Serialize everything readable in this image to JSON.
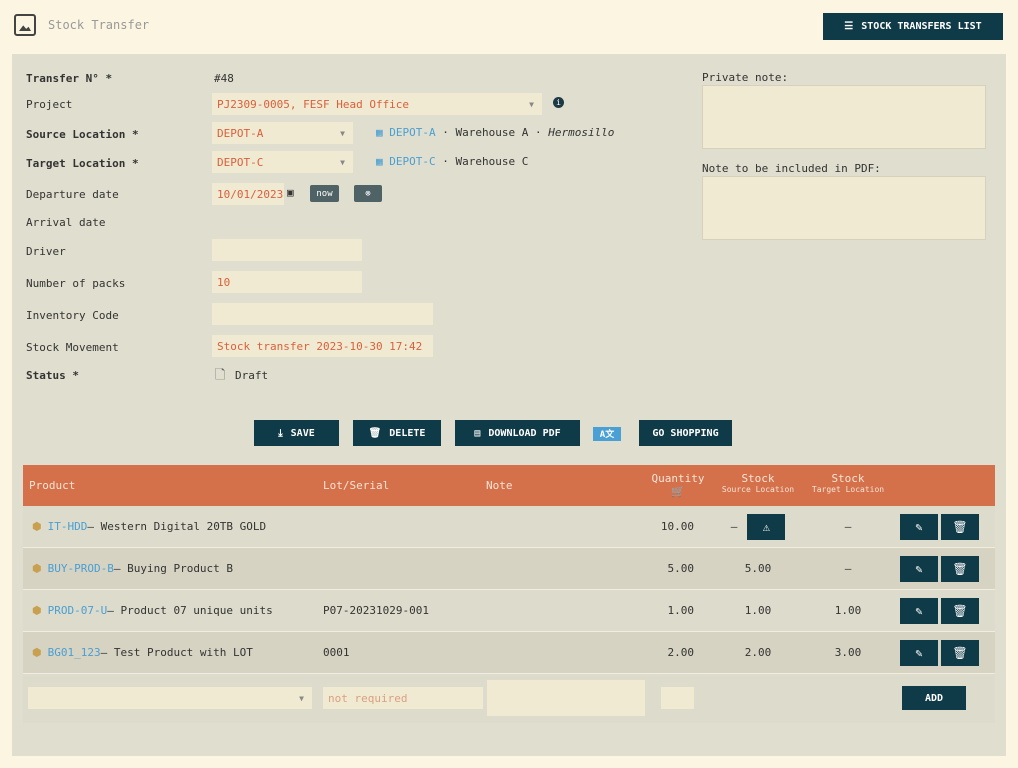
{
  "header": {
    "title": "Stock Transfer",
    "list_button": "STOCK TRANSFERS LIST"
  },
  "form": {
    "transfer_no": {
      "label": "Transfer N° *",
      "value": "#48"
    },
    "project": {
      "label": "Project",
      "value": "PJ2309-0005, FESF Head Office"
    },
    "source": {
      "label": "Source Location *",
      "value": "DEPOT-A",
      "ref": "DEPOT-A",
      "desc": " · Warehouse A · ",
      "city": "Hermosillo"
    },
    "target": {
      "label": "Target Location *",
      "value": "DEPOT-C",
      "ref": "DEPOT-C",
      "desc": " · Warehouse C"
    },
    "departure": {
      "label": "Departure date",
      "value": "10/01/2023",
      "now": "now"
    },
    "arrival": {
      "label": "Arrival date"
    },
    "driver": {
      "label": "Driver",
      "value": ""
    },
    "packs": {
      "label": "Number of packs",
      "value": "10"
    },
    "inventory_code": {
      "label": "Inventory Code",
      "value": ""
    },
    "movement": {
      "label": "Stock Movement",
      "value": "Stock transfer 2023-10-30 17:42"
    },
    "status": {
      "label": "Status *",
      "value": "Draft"
    },
    "private_note": {
      "label": "Private note:"
    },
    "pdf_note": {
      "label": "Note to be included in PDF:"
    }
  },
  "actions": {
    "save": "SAVE",
    "delete": "DELETE",
    "pdf": "DOWNLOAD PDF",
    "shopping": "GO SHOPPING"
  },
  "table": {
    "headers": {
      "product": "Product",
      "lot": "Lot/Serial",
      "note": "Note",
      "qty": "Quantity",
      "stock": "Stock",
      "src": "Source Location",
      "tgt": "Target Location"
    },
    "rows": [
      {
        "ref": "IT-HDD",
        "name": " – Western Digital 20TB GOLD",
        "lot": "",
        "qty": "10.00",
        "src": "–",
        "tgt": "–"
      },
      {
        "ref": "BUY-PROD-B",
        "name": " – Buying Product B",
        "lot": "",
        "qty": "5.00",
        "src": "5.00",
        "tgt": "–"
      },
      {
        "ref": "PROD-07-U",
        "name": " – Product 07 unique units",
        "lot": "P07-20231029-001",
        "qty": "1.00",
        "src": "1.00",
        "tgt": "1.00"
      },
      {
        "ref": "BG01_123",
        "name": " – Test Product with LOT",
        "lot": "0001",
        "qty": "2.00",
        "src": "2.00",
        "tgt": "3.00"
      }
    ],
    "new_row": {
      "lot_placeholder": "not required",
      "add": "ADD"
    }
  }
}
